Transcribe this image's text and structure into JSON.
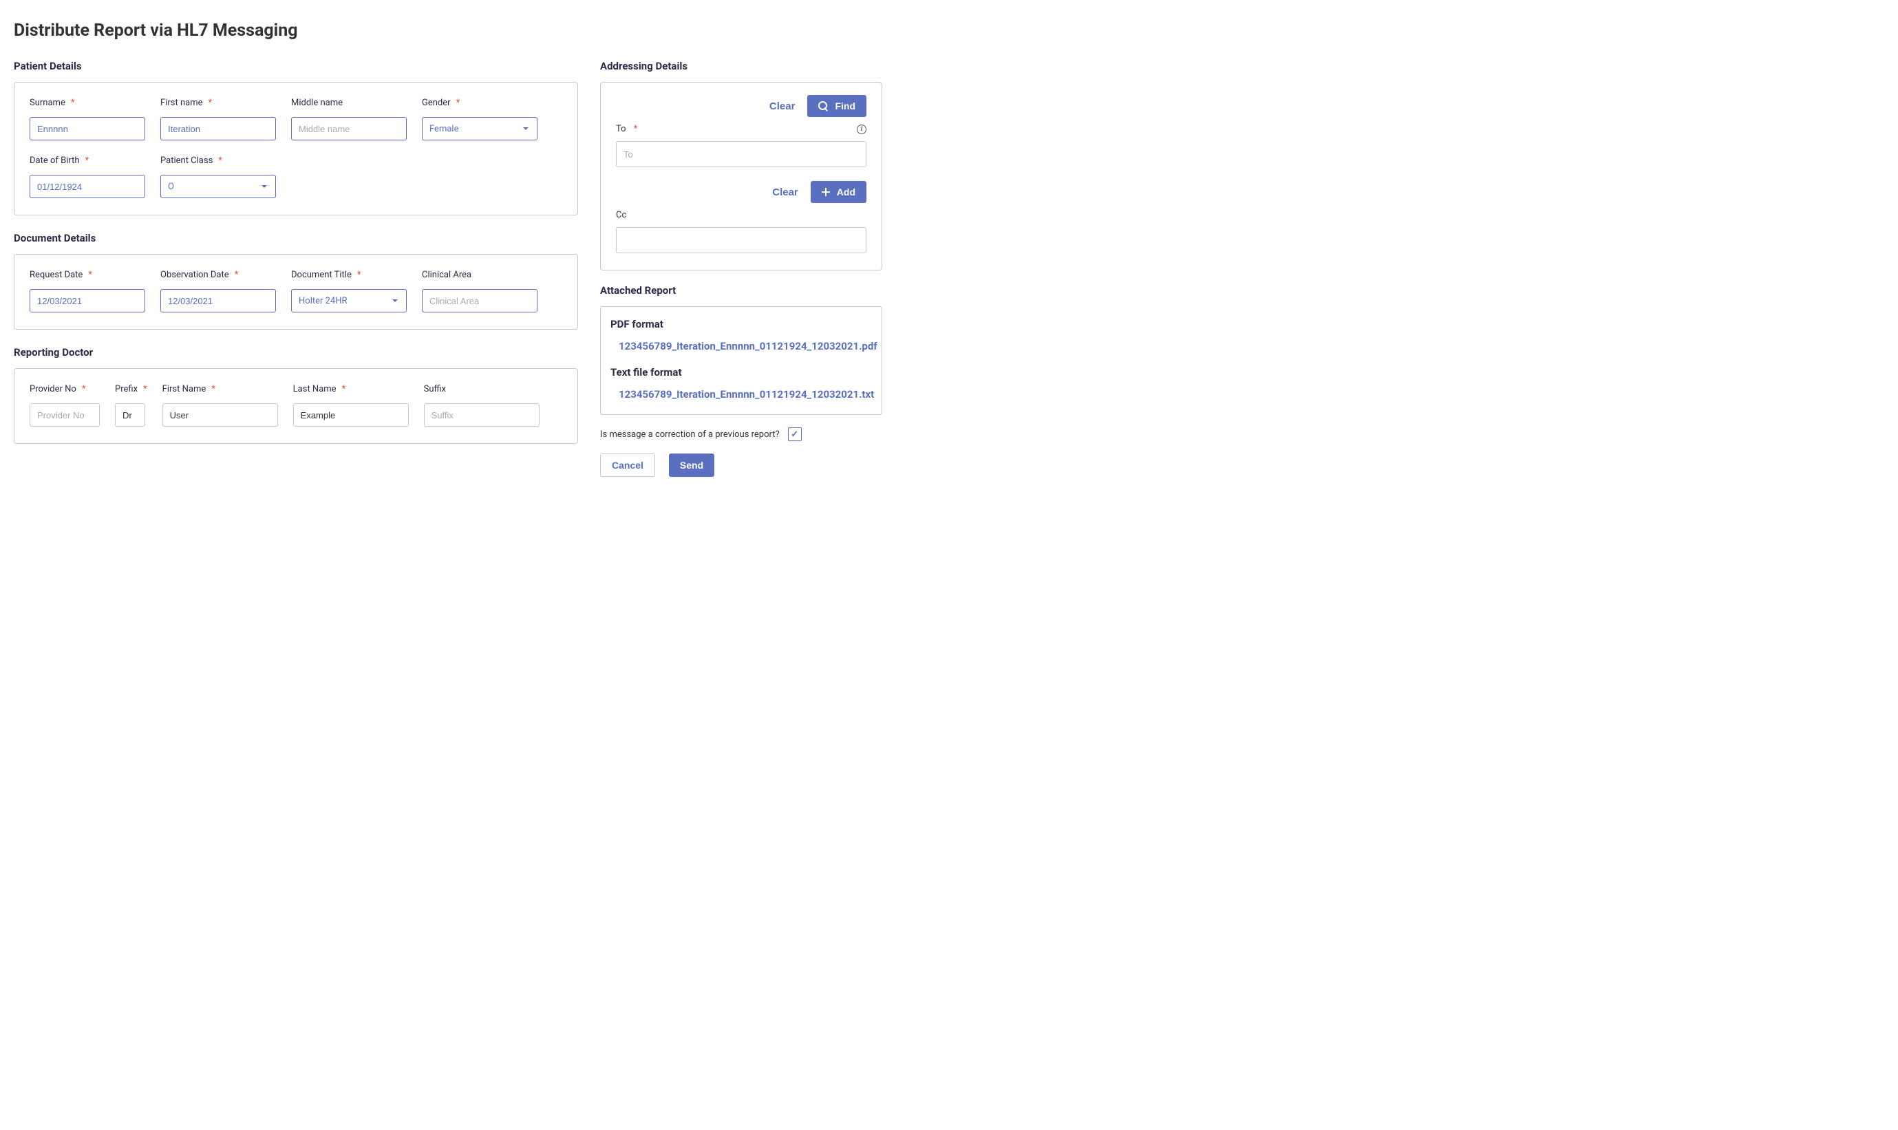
{
  "page_title": "Distribute Report via HL7 Messaging",
  "patient_details": {
    "section_title": "Patient Details",
    "surname": {
      "label": "Surname",
      "value": "Ennnnn"
    },
    "first_name": {
      "label": "First name",
      "value": "Iteration"
    },
    "middle_name": {
      "label": "Middle name",
      "value": "",
      "placeholder": "Middle name"
    },
    "gender": {
      "label": "Gender",
      "value": "Female"
    },
    "dob": {
      "label": "Date of Birth",
      "value": "01/12/1924"
    },
    "patient_class": {
      "label": "Patient Class",
      "value": "O"
    }
  },
  "document_details": {
    "section_title": "Document Details",
    "request_date": {
      "label": "Request Date",
      "value": "12/03/2021"
    },
    "observation_date": {
      "label": "Observation Date",
      "value": "12/03/2021"
    },
    "document_title": {
      "label": "Document Title",
      "value": "Holter 24HR"
    },
    "clinical_area": {
      "label": "Clinical Area",
      "value": "",
      "placeholder": "Clinical Area"
    }
  },
  "reporting_doctor": {
    "section_title": "Reporting Doctor",
    "provider_no": {
      "label": "Provider No",
      "value": "",
      "placeholder": "Provider No"
    },
    "prefix": {
      "label": "Prefix",
      "value": "Dr"
    },
    "first_name": {
      "label": "First Name",
      "value": "User"
    },
    "last_name": {
      "label": "Last Name",
      "value": "Example"
    },
    "suffix": {
      "label": "Suffix",
      "value": "",
      "placeholder": "Suffix"
    }
  },
  "addressing": {
    "section_title": "Addressing Details",
    "clear_label": "Clear",
    "find_label": "Find",
    "add_label": "Add",
    "to": {
      "label": "To",
      "value": "",
      "placeholder": "To"
    },
    "cc": {
      "label": "Cc",
      "value": ""
    }
  },
  "attached": {
    "section_title": "Attached Report",
    "pdf_heading": "PDF format",
    "pdf_filename": "123456789_Iteration_Ennnnn_01121924_12032021.pdf",
    "txt_heading": "Text file format",
    "txt_filename": "123456789_Iteration_Ennnnn_01121924_12032021.txt"
  },
  "correction": {
    "label": "Is message a correction of a previous report?",
    "checked": true
  },
  "actions": {
    "cancel_label": "Cancel",
    "send_label": "Send"
  }
}
